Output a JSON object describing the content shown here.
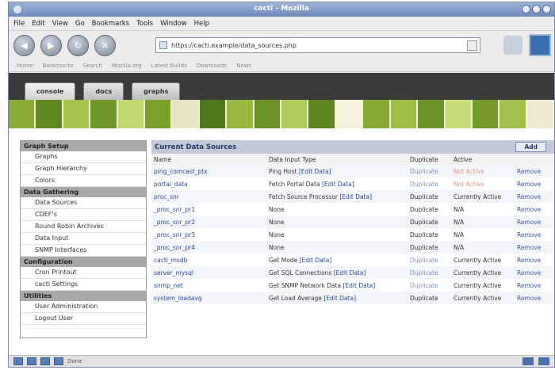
{
  "window": {
    "title": "cacti - Mozilla"
  },
  "menu": [
    "File",
    "Edit",
    "View",
    "Go",
    "Bookmarks",
    "Tools",
    "Window",
    "Help"
  ],
  "nav": {
    "back": "◀",
    "forward": "▶",
    "reload": "↻",
    "stop": "✕"
  },
  "url": {
    "value": "https://cacti.example/data_sources.php"
  },
  "bookmarks": [
    "Home",
    "Bookmarks",
    "Search",
    "Mozilla.org",
    "Latest Builds",
    "Downloads",
    "News"
  ],
  "tabs": [
    {
      "label": "console"
    },
    {
      "label": "docs"
    },
    {
      "label": "graphs"
    }
  ],
  "sidebar": {
    "sections": [
      {
        "heading": "Graph Setup",
        "items": [
          "Graphs",
          "Graph Hierarchy",
          "Colors"
        ]
      },
      {
        "heading": "Data Gathering",
        "items": [
          "Data Sources",
          "CDEF's",
          "Round Robin Archives",
          "Data Input",
          "SNMP Interfaces"
        ]
      },
      {
        "heading": "Configuration",
        "items": [
          "Cron Printout",
          "cacti Settings"
        ]
      },
      {
        "heading": "Utilities",
        "items": [
          "User Administration",
          "Logout User"
        ]
      }
    ]
  },
  "main": {
    "title": "Current Data Sources",
    "add_label": "Add",
    "columns": [
      "Name",
      "Data Input Type",
      "Duplicate",
      "Active",
      ""
    ],
    "rows": [
      {
        "name": "ping_comcast_ptx",
        "input": "Ping Host",
        "edit": "[Edit Data]",
        "duplicate": "Duplicate",
        "active": "Not Active",
        "remove": "Remove"
      },
      {
        "name": "portal_data",
        "input": "Fetch Portal Data",
        "edit": "[Edit Data]",
        "duplicate": "Duplicate",
        "active": "Not Active",
        "remove": "Remove"
      },
      {
        "name": "proc_snr",
        "input": "Fetch Source Processor",
        "edit": "[Edit Data]",
        "duplicate": "Duplicate",
        "active": "Currently Active",
        "remove": "Remove"
      },
      {
        "name": "_proc_snr_pr1",
        "input": "None",
        "edit": "",
        "duplicate": "Duplicate",
        "active": "N/A",
        "remove": "Remove"
      },
      {
        "name": "_proc_snr_pr2",
        "input": "None",
        "edit": "",
        "duplicate": "Duplicate",
        "active": "N/A",
        "remove": "Remove"
      },
      {
        "name": "_proc_snr_pr3",
        "input": "None",
        "edit": "",
        "duplicate": "Duplicate",
        "active": "N/A",
        "remove": "Remove"
      },
      {
        "name": "_proc_snr_pr4",
        "input": "None",
        "edit": "",
        "duplicate": "Duplicate",
        "active": "N/A",
        "remove": "Remove"
      },
      {
        "name": "cacti_msdb",
        "input": "Get Mode",
        "edit": "[Edit Data]",
        "duplicate": "Duplicate",
        "active": "Currently Active",
        "remove": "Remove"
      },
      {
        "name": "server_mysql",
        "input": "Get SQL Connections",
        "edit": "[Edit Data]",
        "duplicate": "Duplicate",
        "active": "Currently Active",
        "remove": "Remove"
      },
      {
        "name": "snmp_net",
        "input": "Get SNMP Network Data",
        "edit": "[Edit Data]",
        "duplicate": "Duplicate",
        "active": "Currently Active",
        "remove": "Remove"
      },
      {
        "name": "system_loadavg",
        "input": "Get Load Average",
        "edit": "[Edit Data]",
        "duplicate": "Duplicate",
        "active": "Currently Active",
        "remove": "Remove"
      }
    ]
  },
  "status": {
    "text": "Done"
  },
  "colors": {
    "banner": [
      "#8bab38",
      "#5f8a22",
      "#a7c44a",
      "#6f9628",
      "#c2d870",
      "#7aa02c",
      "#e8e3c0",
      "#4f7a1c",
      "#98b840",
      "#6a9224",
      "#b0cc58",
      "#5c8620",
      "#f4f1de",
      "#86a834",
      "#9fbe44",
      "#6c9428",
      "#c8dc7c",
      "#75992a",
      "#a3c04c",
      "#edeacf"
    ]
  }
}
